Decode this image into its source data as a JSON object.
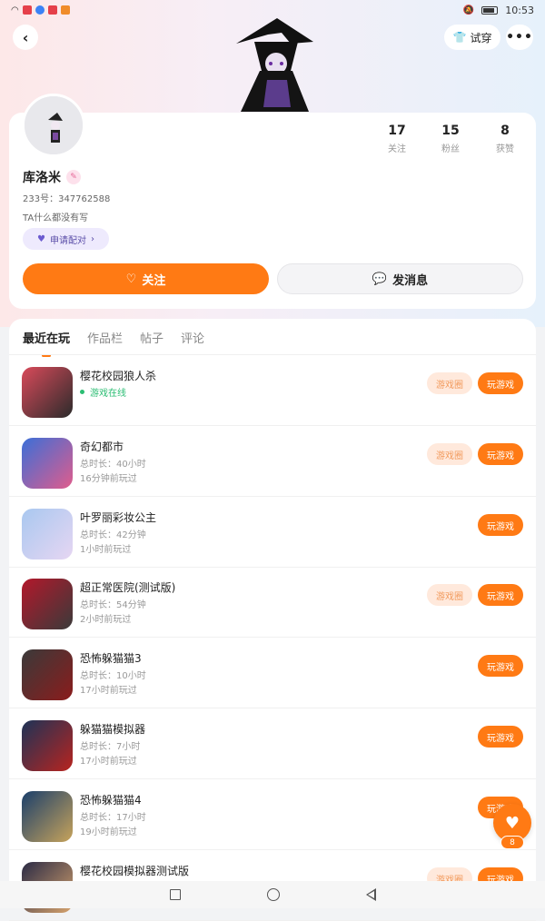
{
  "status_bar": {
    "time": "10:53"
  },
  "header": {
    "tryon_label": "试穿",
    "more_label": "•••"
  },
  "profile": {
    "name": "库洛米",
    "uid": "233号：347762588",
    "bio": "TA什么都没有写",
    "pair_label": "申请配对",
    "stats": [
      {
        "value": "17",
        "label": "关注"
      },
      {
        "value": "15",
        "label": "粉丝"
      },
      {
        "value": "8",
        "label": "获赞"
      }
    ],
    "follow_label": "关注",
    "message_label": "发消息"
  },
  "tabs": [
    "最近在玩",
    "作品栏",
    "帖子",
    "评论"
  ],
  "games": [
    {
      "name": "樱花校园狼人杀",
      "line1": "游戏在线",
      "line2": "",
      "online": true,
      "circle": true,
      "colors": [
        "#d94a5a",
        "#2b2b2b"
      ]
    },
    {
      "name": "奇幻都市",
      "line1": "总时长：40小时",
      "line2": "16分钟前玩过",
      "online": false,
      "circle": true,
      "colors": [
        "#3b6fd8",
        "#e05c8c"
      ]
    },
    {
      "name": "叶罗丽彩妆公主",
      "line1": "总时长：42分钟",
      "line2": "1小时前玩过",
      "online": false,
      "circle": false,
      "colors": [
        "#a9c8f0",
        "#e6d6f2"
      ]
    },
    {
      "name": "超正常医院(测试版)",
      "line1": "总时长：54分钟",
      "line2": "2小时前玩过",
      "online": false,
      "circle": true,
      "colors": [
        "#b3182b",
        "#3a3a3a"
      ]
    },
    {
      "name": "恐怖躲猫猫3",
      "line1": "总时长：10小时",
      "line2": "17小时前玩过",
      "online": false,
      "circle": false,
      "colors": [
        "#3a3a3a",
        "#8b1c1c"
      ]
    },
    {
      "name": "躲猫猫模拟器",
      "line1": "总时长：7小时",
      "line2": "17小时前玩过",
      "online": false,
      "circle": false,
      "colors": [
        "#1d3357",
        "#b8241f"
      ]
    },
    {
      "name": "恐怖躲猫猫4",
      "line1": "总时长：17小时",
      "line2": "19小时前玩过",
      "online": false,
      "circle": false,
      "colors": [
        "#1b3f6b",
        "#c7a35b"
      ]
    },
    {
      "name": "樱花校园模拟器测试版",
      "line1": "",
      "line2": "",
      "online": false,
      "circle": true,
      "colors": [
        "#2b2b45",
        "#d8a46e"
      ]
    }
  ],
  "game_circle_label": "游戏圈",
  "play_label": "玩游戏",
  "like_count": "8"
}
